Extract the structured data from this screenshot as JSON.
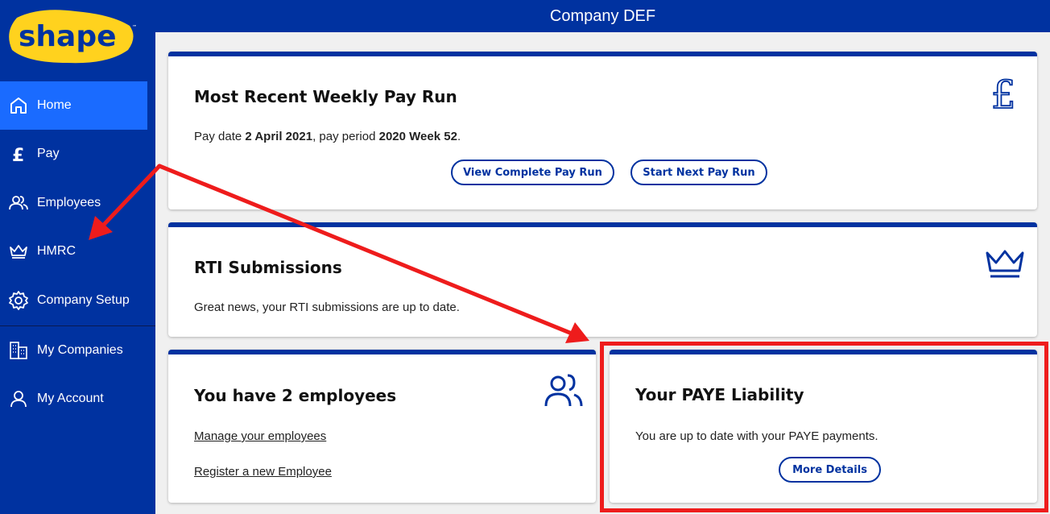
{
  "app": {
    "logo_text": "shape",
    "logo_tm": "™",
    "company_name": "Company DEF"
  },
  "sidebar": {
    "items": [
      {
        "label": "Home",
        "icon": "home-icon",
        "active": true
      },
      {
        "label": "Pay",
        "icon": "pound-icon",
        "active": false
      },
      {
        "label": "Employees",
        "icon": "people-icon",
        "active": false
      },
      {
        "label": "HMRC",
        "icon": "crown-icon",
        "active": false
      },
      {
        "label": "Company Setup",
        "icon": "gear-icon",
        "active": false
      },
      {
        "label": "My Companies",
        "icon": "buildings-icon",
        "active": false
      },
      {
        "label": "My Account",
        "icon": "user-icon",
        "active": false
      }
    ]
  },
  "cards": {
    "pay_run": {
      "title": "Most Recent Weekly Pay Run",
      "text_prefix": "Pay date ",
      "pay_date": "2 April 2021",
      "text_middle": ", pay period ",
      "pay_period": "2020 Week 52",
      "text_suffix": ".",
      "view_button": "View Complete Pay Run",
      "next_button": "Start Next Pay Run",
      "icon": "pound-icon"
    },
    "rti": {
      "title": "RTI Submissions",
      "text": "Great news, your RTI submissions are up to date.",
      "icon": "crown-icon"
    },
    "employees": {
      "title": "You have 2 employees",
      "manage_link": "Manage your employees",
      "register_link": "Register a new Employee",
      "icon": "people-icon"
    },
    "paye": {
      "title": "Your PAYE Liability",
      "text": "You are up to date with your PAYE payments.",
      "details_button": "More Details"
    }
  },
  "annotations": {
    "color": "#ee1c1c"
  },
  "colors": {
    "brand_blue": "#0032a0",
    "active_blue": "#1a6bff",
    "logo_yellow": "#ffd21e"
  }
}
